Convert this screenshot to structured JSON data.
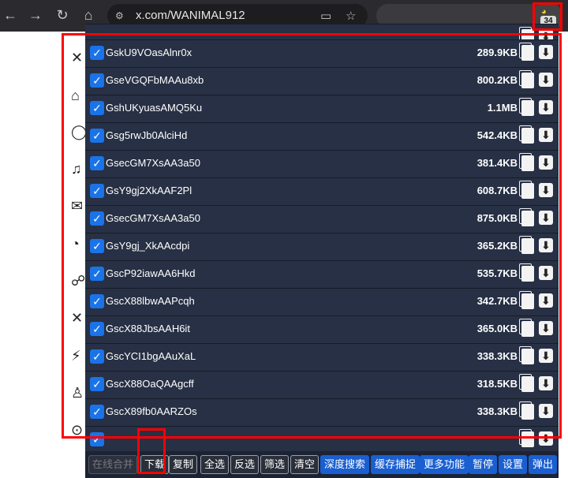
{
  "browser": {
    "url": "x.com/WANIMAL912",
    "extension_count": "34"
  },
  "icons": {
    "back": "arrow-left-icon",
    "forward": "arrow-right-icon",
    "reload": "reload-icon",
    "home": "home-icon",
    "site_info": "tune-icon",
    "cast": "cast-icon",
    "bookmark": "star-icon"
  },
  "files": [
    {
      "name": "GskU9VOasAlnr0x",
      "size": "289.9KB"
    },
    {
      "name": "GseVGQFbMAAu8xb",
      "size": "800.2KB"
    },
    {
      "name": "GshUKyuasAMQ5Ku",
      "size": "1.1MB"
    },
    {
      "name": "Gsg5rwJb0AlciHd",
      "size": "542.4KB"
    },
    {
      "name": "GsecGM7XsAA3a50",
      "size": "381.4KB"
    },
    {
      "name": "GsY9gj2XkAAF2Pl",
      "size": "608.7KB"
    },
    {
      "name": "GsecGM7XsAA3a50",
      "size": "875.0KB"
    },
    {
      "name": "GsY9gj_XkAAcdpi",
      "size": "365.2KB"
    },
    {
      "name": "GscP92iawAA6Hkd",
      "size": "535.7KB"
    },
    {
      "name": "GscX88lbwAAPcqh",
      "size": "342.7KB"
    },
    {
      "name": "GscX88JbsAAH6it",
      "size": "365.0KB"
    },
    {
      "name": "GscYCI1bgAAuXaL",
      "size": "338.3KB"
    },
    {
      "name": "GscX88OaQAAgcff",
      "size": "318.5KB"
    },
    {
      "name": "GscX89fb0AARZOs",
      "size": "338.3KB"
    }
  ],
  "toolbar": {
    "merge_online": "在线合并",
    "download": "下载",
    "copy": "复制",
    "select_all": "全选",
    "invert": "反选",
    "filter": "筛选",
    "clear": "清空",
    "deep_search": "深度搜索",
    "cache_capture": "缓存捕捉",
    "more": "更多功能",
    "pause": "暂停",
    "settings": "设置",
    "popout": "弹出"
  }
}
